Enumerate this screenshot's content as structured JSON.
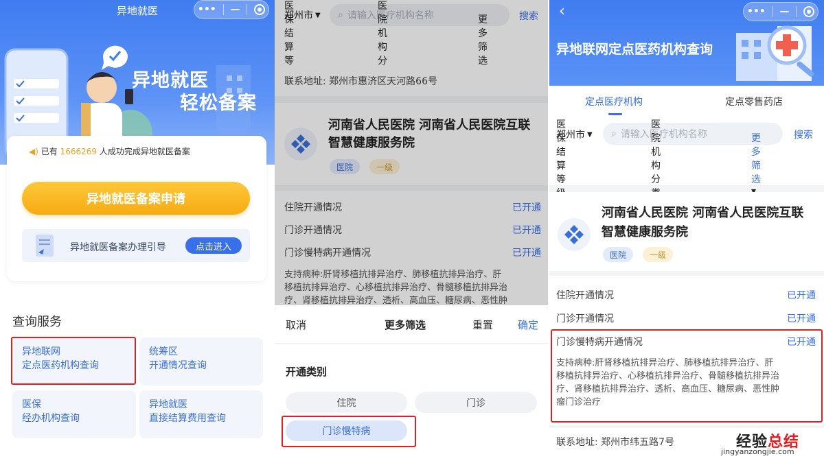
{
  "panel1": {
    "title": "异地就医",
    "slogan_line1": "异地就医",
    "slogan_line2": "轻松备案",
    "notice_prefix": "已有",
    "notice_count": "1666269",
    "notice_suffix": "人成功完成异地就医备案",
    "apply_button": "异地就医备案申请",
    "guide_text": "异地就医备案办理引导",
    "guide_button": "点击进入",
    "section_title": "查询服务",
    "services": [
      {
        "line1": "异地联网",
        "line2": "定点医药机构查询"
      },
      {
        "line1": "统筹区",
        "line2": "开通情况查询"
      },
      {
        "line1": "医保",
        "line2": "经办机构查询"
      },
      {
        "line1": "异地就医",
        "line2": "直接结算费用查询"
      }
    ]
  },
  "panel2": {
    "city": "郑州市",
    "search_placeholder": "请输入医疗机构名称",
    "search_button": "搜索",
    "filters": [
      "医保结算等级",
      "医院机构分类",
      "更多筛选"
    ],
    "address_label": "联系地址:",
    "address_value": "郑州市惠济区天河路66号",
    "org_name_line1": "河南省人民医院 河南省人民医院互联",
    "org_name_line2": "智慧健康服务院",
    "tag_type": "医院",
    "tag_level": "一级",
    "rows": [
      {
        "label": "住院开通情况",
        "value": "已开通"
      },
      {
        "label": "门诊开通情况",
        "value": "已开通"
      },
      {
        "label": "门诊慢特病开通情况",
        "value": "已开通"
      }
    ],
    "disease_lines": [
      "支持病种:肝肾移植抗排异治疗、肺移植抗排异治疗、肝",
      "移植抗排异治疗、心移植抗排异治疗、骨髓移植抗排异治",
      "疗、肾移植抗排异治疗、透析、高血压、糖尿病、恶性肿"
    ],
    "sheet": {
      "cancel": "取消",
      "title": "更多筛选",
      "reset": "重置",
      "confirm": "确定",
      "category_title": "开通类别",
      "chips": [
        "住院",
        "门诊",
        "门诊慢特病"
      ]
    }
  },
  "panel3": {
    "back_icon": "chevron-left-icon",
    "header_title": "异地联网定点医药机构查询",
    "tabs": [
      "定点医疗机构",
      "定点零售药店"
    ],
    "city": "郑州市",
    "search_placeholder": "请输入医疗机构名称",
    "search_button": "搜索",
    "filters": [
      "医保结算等级",
      "医院机构分类",
      "更多筛选"
    ],
    "org_name_line1": "河南省人民医院 河南省人民医院互联",
    "org_name_line2": "智慧健康服务院",
    "tag_type": "医院",
    "tag_level": "一级",
    "rows": [
      {
        "label": "住院开通情况",
        "value": "已开通"
      },
      {
        "label": "门诊开通情况",
        "value": "已开通"
      },
      {
        "label": "门诊慢特病开通情况",
        "value": "已开通"
      }
    ],
    "disease_lines": [
      "支持病种:肝肾移植抗排异治疗、肺移植抗排异治疗、肝",
      "移植抗排异治疗、心移植抗排异治疗、骨髓移植抗排异治",
      "疗、肾移植抗排异治疗、透析、高血压、糖尿病、恶性肿",
      "瘤门诊治疗"
    ],
    "address_label": "联系地址:",
    "address_value": "郑州市纬五路7号"
  },
  "watermark": {
    "cn_black": "经验",
    "cn_red": "总结",
    "url": "jingyanzongjie.com"
  },
  "colors": {
    "primary_blue": "#3770e8",
    "apply_yellow": "#f6ab12",
    "highlight_red": "#e02020"
  }
}
